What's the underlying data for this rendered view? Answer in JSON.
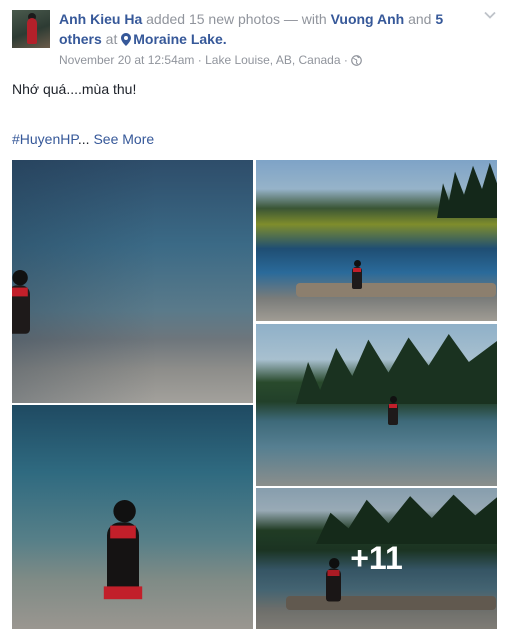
{
  "post": {
    "author": "Anh Kieu Ha",
    "action_text": " added 15 new photos — with ",
    "tagged_user": "Vuong Anh",
    "and_text": " and ",
    "others_link": "5 others",
    "at_text": " at ",
    "location": "Moraine Lake.",
    "timestamp": "November 20 at 12:54am",
    "separator": " · ",
    "place": "Lake Louise, AB, Canada",
    "privacy_icon": "globe-icon",
    "menu_icon": "chevron-down-icon",
    "location_icon": "map-pin-icon",
    "message": "Nhớ quá....mùa thu!",
    "hashtag": "#HuyenHP",
    "ellipsis": "...",
    "see_more": "See More"
  },
  "gallery": {
    "more_count": "+11"
  },
  "colors": {
    "link": "#365899",
    "muted": "#90949c",
    "text": "#1d2129",
    "accent_red": "#c21f2a"
  }
}
